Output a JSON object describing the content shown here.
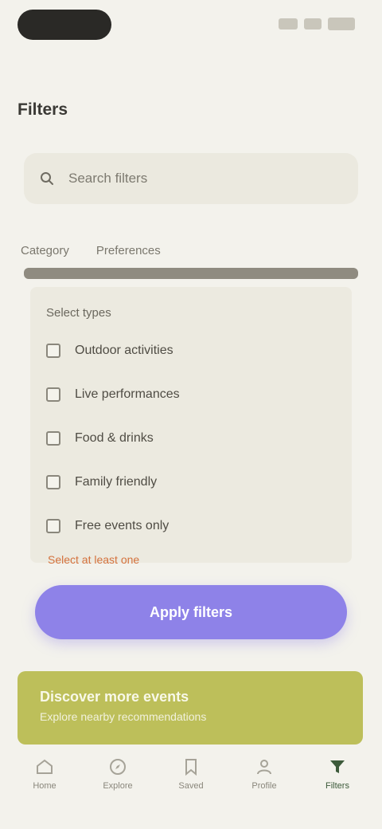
{
  "app": {
    "title": "Filters",
    "accent": "#8e82e8",
    "promo_color": "#bdbf5a",
    "warning_color": "#d4713c"
  },
  "search": {
    "placeholder": "Search filters",
    "icon": "search-icon"
  },
  "section": {
    "tab_left": "Category",
    "tab_right": "Preferences"
  },
  "panel": {
    "label": "Select types",
    "options": [
      {
        "label": "Outdoor activities",
        "checked": false
      },
      {
        "label": "Live performances",
        "checked": false
      },
      {
        "label": "Food & drinks",
        "checked": false
      },
      {
        "label": "Family friendly",
        "checked": false
      },
      {
        "label": "Free events only",
        "checked": false
      }
    ]
  },
  "warning": "Select at least one",
  "primary_button": "Apply filters",
  "promo": {
    "title": "Discover more events",
    "subtitle": "Explore nearby recommendations"
  },
  "tabbar": [
    {
      "label": "Home",
      "icon": "home-icon",
      "active": false
    },
    {
      "label": "Explore",
      "icon": "compass-icon",
      "active": false
    },
    {
      "label": "Saved",
      "icon": "bookmark-icon",
      "active": false
    },
    {
      "label": "Profile",
      "icon": "user-icon",
      "active": false
    },
    {
      "label": "Filters",
      "icon": "filter-icon",
      "active": true
    }
  ]
}
